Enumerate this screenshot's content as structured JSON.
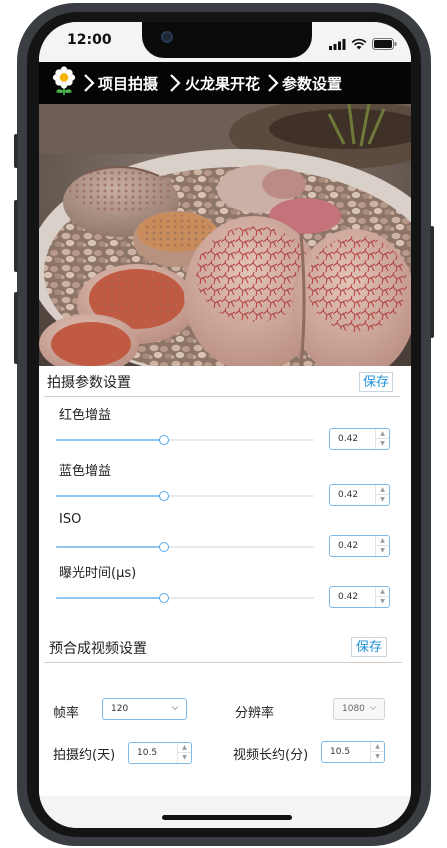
{
  "status_bar": {
    "time": "12:00",
    "icons": [
      "cellular-signal-icon",
      "wifi-icon",
      "battery-icon"
    ]
  },
  "nav": {
    "logo_icon": "flower-logo-icon",
    "breadcrumbs": [
      "项目拍摄",
      "火龙果开花",
      "参数设置"
    ],
    "separator_icon": "chevron-right-icon"
  },
  "capture_settings": {
    "title": "拍摄参数设置",
    "save_label": "保存",
    "params": [
      {
        "label": "红色增益",
        "value": "0.42",
        "slider_level": 0.42
      },
      {
        "label": "蓝色增益",
        "value": "0.42",
        "slider_level": 0.42
      },
      {
        "label": "ISO",
        "value": "0.42",
        "slider_level": 0.42
      },
      {
        "label": "曝光时间(μs)",
        "value": "0.42",
        "slider_level": 0.42
      }
    ]
  },
  "video_settings": {
    "title": "预合成视频设置",
    "save_label": "保存",
    "frame_rate": {
      "label": "帧率",
      "value": "120"
    },
    "resolution": {
      "label": "分辨率",
      "value": "1080"
    },
    "capture_days": {
      "label": "拍摄约(天)",
      "value": "10.5"
    },
    "video_length": {
      "label": "视频长约(分)",
      "value": "10.5"
    }
  },
  "colors": {
    "accent": "#1e90d8",
    "slider_fill": "#8fc5ef",
    "nav_bg": "#050505"
  }
}
